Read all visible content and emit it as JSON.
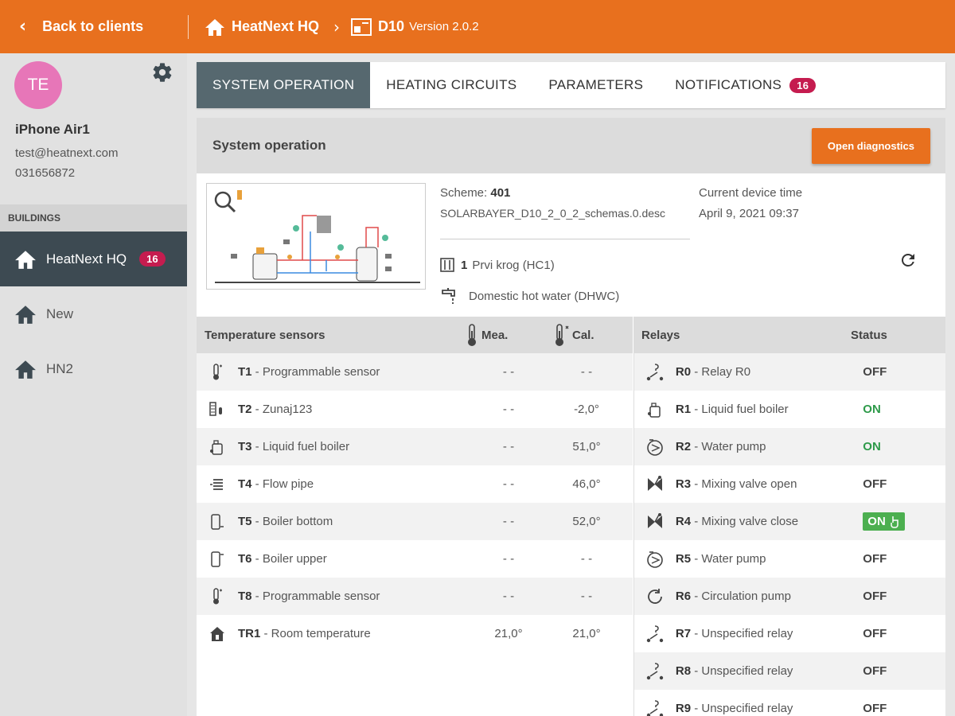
{
  "topbar": {
    "back_label": "Back to clients",
    "building": "HeatNext HQ",
    "device": "D10",
    "version": "Version 2.0.2"
  },
  "profile": {
    "initials": "TE",
    "name": "iPhone Air1",
    "email": "test@heatnext.com",
    "phone": "031656872"
  },
  "buildings": {
    "heading": "BUILDINGS",
    "items": [
      {
        "label": "HeatNext HQ",
        "badge": "16"
      },
      {
        "label": "New"
      },
      {
        "label": "HN2"
      }
    ]
  },
  "tabs": [
    {
      "label": "SYSTEM OPERATION"
    },
    {
      "label": "HEATING CIRCUITS"
    },
    {
      "label": "PARAMETERS"
    },
    {
      "label": "NOTIFICATIONS",
      "badge": "16"
    }
  ],
  "panel": {
    "title": "System operation",
    "diagnostics_label": "Open diagnostics",
    "scheme_label": "Scheme:",
    "scheme_value": "401",
    "scheme_file": "SOLARBAYER_D10_2_0_2_schemas.0.desc",
    "circuit_num": "1",
    "circuit": "Prvi krog (HC1)",
    "dhw": "Domestic hot water (DHWC)",
    "time_label": "Current device time",
    "time_value": "April 9, 2021 09:37"
  },
  "sensors": {
    "header": "Temperature sensors",
    "mea": "Mea.",
    "cal": "Cal.",
    "rows": [
      {
        "id": "T1",
        "name": " - Programmable sensor",
        "mea": "- -",
        "cal": "- -",
        "icon": "thermometer-icon"
      },
      {
        "id": "T2",
        "name": " - Zunaj123",
        "mea": "- -",
        "cal": "-2,0°",
        "icon": "outdoor-sensor-icon"
      },
      {
        "id": "T3",
        "name": " - Liquid fuel boiler",
        "mea": "- -",
        "cal": "51,0°",
        "icon": "boiler-icon"
      },
      {
        "id": "T4",
        "name": " - Flow pipe",
        "mea": "- -",
        "cal": "46,0°",
        "icon": "flow-pipe-icon"
      },
      {
        "id": "T5",
        "name": " - Boiler bottom",
        "mea": "- -",
        "cal": "52,0°",
        "icon": "tank-bottom-icon"
      },
      {
        "id": "T6",
        "name": " - Boiler upper",
        "mea": "- -",
        "cal": "- -",
        "icon": "tank-top-icon"
      },
      {
        "id": "T8",
        "name": " - Programmable sensor",
        "mea": "- -",
        "cal": "- -",
        "icon": "thermometer-icon"
      },
      {
        "id": "TR1",
        "name": " - Room temperature",
        "mea": "21,0°",
        "cal": "21,0°",
        "icon": "room-icon"
      }
    ]
  },
  "relays": {
    "header": "Relays",
    "status": "Status",
    "rows": [
      {
        "id": "R0",
        "name": " - Relay R0",
        "status": "OFF",
        "icon": "relay-icon"
      },
      {
        "id": "R1",
        "name": " - Liquid fuel boiler",
        "status": "ON",
        "icon": "boiler-icon"
      },
      {
        "id": "R2",
        "name": " - Water pump",
        "status": "ON",
        "icon": "pump-icon"
      },
      {
        "id": "R3",
        "name": " - Mixing valve open",
        "status": "OFF",
        "icon": "mixing-valve-icon"
      },
      {
        "id": "R4",
        "name": " - Mixing valve close",
        "status": "ON",
        "icon": "mixing-valve-icon",
        "manual": true
      },
      {
        "id": "R5",
        "name": " - Water pump",
        "status": "OFF",
        "icon": "pump-icon"
      },
      {
        "id": "R6",
        "name": " - Circulation pump",
        "status": "OFF",
        "icon": "circulation-pump-icon"
      },
      {
        "id": "R7",
        "name": " - Unspecified relay",
        "status": "OFF",
        "icon": "relay-icon"
      },
      {
        "id": "R8",
        "name": " - Unspecified relay",
        "status": "OFF",
        "icon": "relay-icon"
      },
      {
        "id": "R9",
        "name": " - Unspecified relay",
        "status": "OFF",
        "icon": "relay-icon"
      }
    ]
  },
  "colors": {
    "accent": "#e8701e",
    "active_nav": "#3d4a52",
    "badge": "#c51c4f",
    "on": "#2e9a4a"
  }
}
